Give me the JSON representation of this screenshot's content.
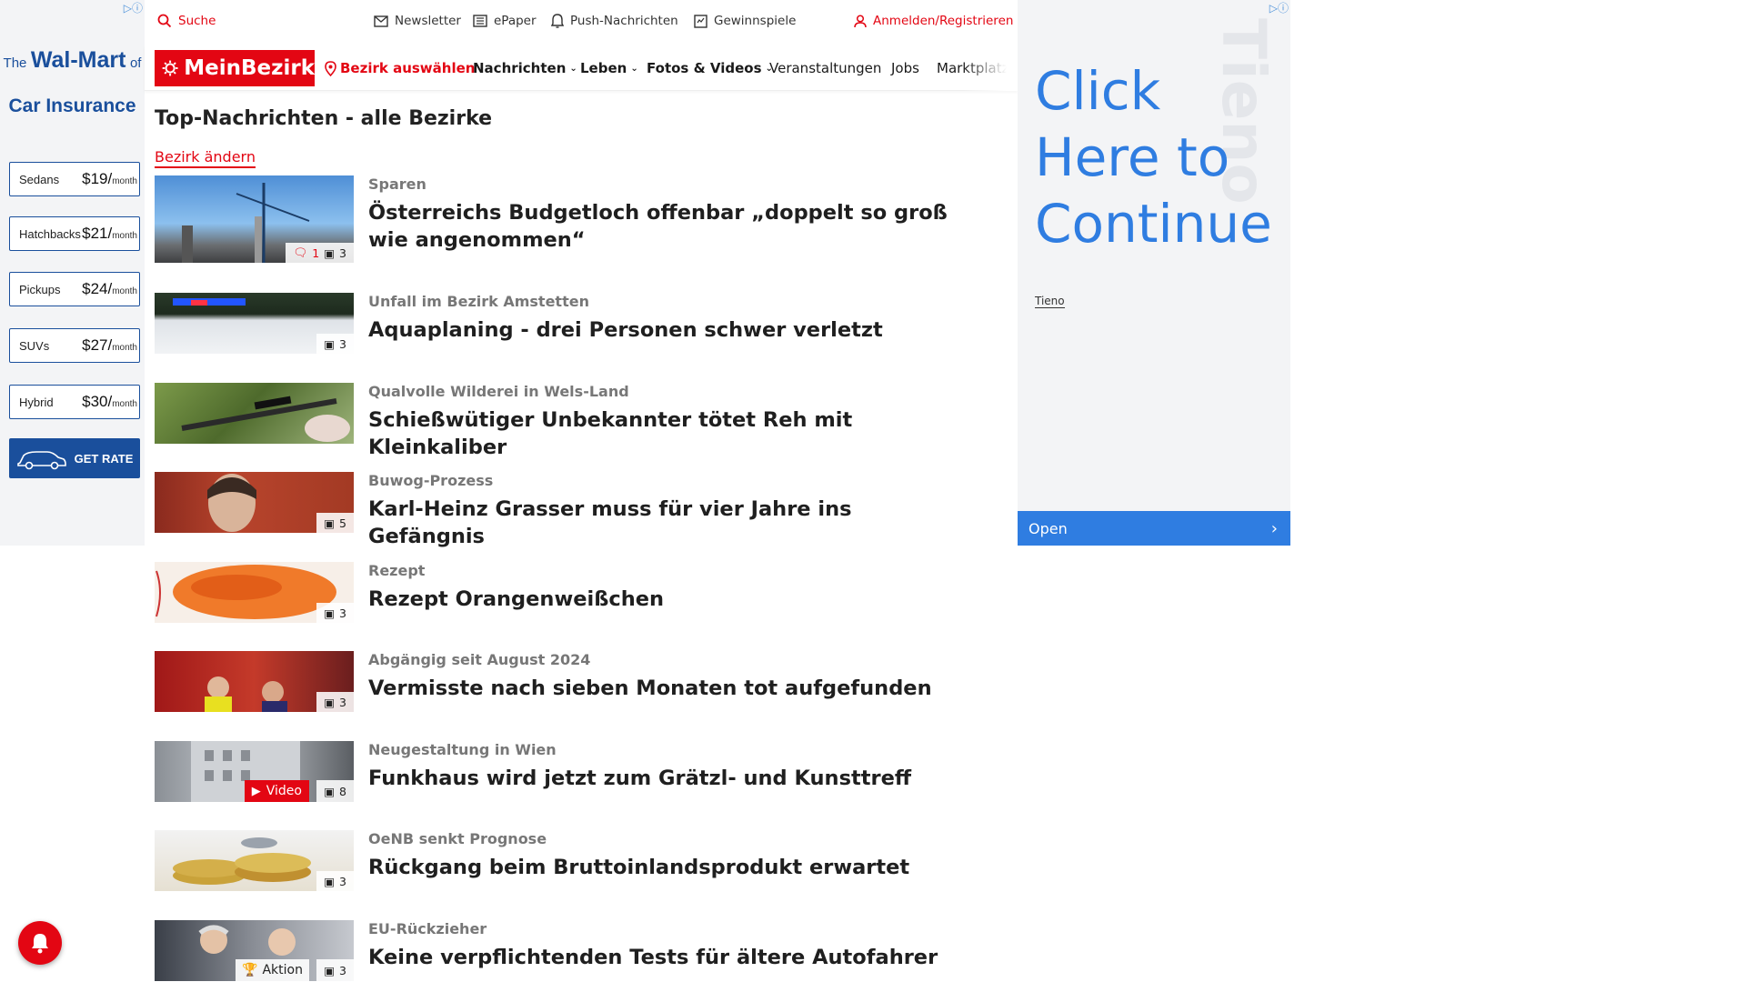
{
  "left_ad": {
    "the_text": "The",
    "brand_text": "Wal-Mart",
    "of_text": "of",
    "line2": "Car Insurance",
    "rows": [
      {
        "category": "Sedans",
        "price": "$19/",
        "per": "month"
      },
      {
        "category": "Hatchbacks",
        "price": "$21/",
        "per": "month"
      },
      {
        "category": "Pickups",
        "price": "$24/",
        "per": "month"
      },
      {
        "category": "SUVs",
        "price": "$27/",
        "per": "month"
      },
      {
        "category": "Hybrid",
        "price": "$30/",
        "per": "month"
      }
    ],
    "button": "GET RATE"
  },
  "topbar": {
    "search": "Suche",
    "newsletter": "Newsletter",
    "epaper": "ePaper",
    "push": "Push-Nachrichten",
    "gewinnspiele": "Gewinnspiele",
    "login": "Anmelden/Registrieren"
  },
  "nav": {
    "logo": "MeinBezirk",
    "district": "Bezirk auswählen",
    "items": [
      "Nachrichten",
      "Leben",
      "Fotos & Videos",
      "Veranstaltungen",
      "Jobs",
      "Marktplatz"
    ]
  },
  "main": {
    "title": "Top-Nachrichten - alle Bezirke",
    "change_link": "Bezirk ändern",
    "articles": [
      {
        "kicker": "Sparen",
        "headline": "Österreichs Budgetloch offenbar „doppelt so groß wie angenommen“",
        "comments": "1",
        "images": "3"
      },
      {
        "kicker": "Unfall im Bezirk Amstetten",
        "headline": "Aquaplaning - drei Personen schwer verletzt",
        "images": "3"
      },
      {
        "kicker": "Qualvolle Wilderei in Wels-Land",
        "headline": "Schießwütiger Unbekannter tötet Reh mit Kleinkaliber"
      },
      {
        "kicker": "Buwog-Prozess",
        "headline": "Karl-Heinz Grasser muss für vier Jahre ins Gefängnis",
        "images": "5"
      },
      {
        "kicker": "Rezept",
        "headline": "Rezept Orangenweißchen",
        "images": "3"
      },
      {
        "kicker": "Abgängig seit August 2024",
        "headline": "Vermisste nach sieben Monaten tot aufgefunden",
        "images": "3"
      },
      {
        "kicker": "Neugestaltung in Wien",
        "headline": "Funkhaus wird jetzt zum Grätzl- und Kunsttreff",
        "video_label": "Video",
        "images": "8"
      },
      {
        "kicker": "OeNB senkt Prognose",
        "headline": "Rückgang beim Bruttoinlandsprodukt erwartet",
        "images": "3"
      },
      {
        "kicker": "EU-Rückzieher",
        "headline": "Keine verpflichtenden Tests für ältere Autofahrer",
        "aktion_label": "Aktion",
        "images": "3"
      }
    ]
  },
  "right_ad": {
    "cta": "Click Here to Continue",
    "brand": "Tieno",
    "watermark": "Tieno",
    "button": "Open"
  },
  "colors": {
    "brand_red": "#e30613",
    "ad_blue": "#2f7de1",
    "ad_navy": "#1a4f9c"
  }
}
